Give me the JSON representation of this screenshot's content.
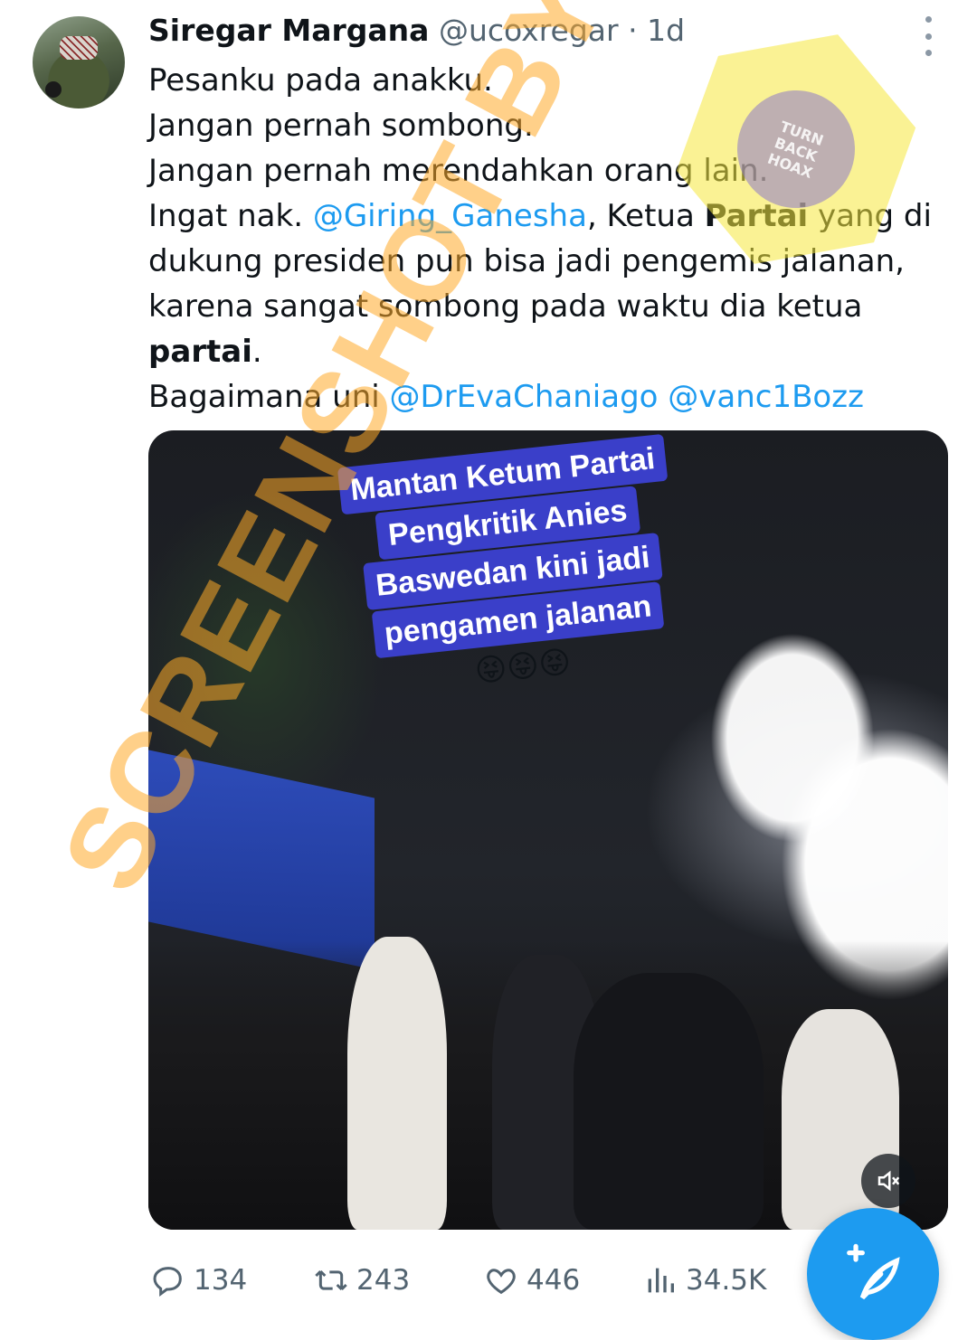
{
  "tweet": {
    "author_name": "Siregar Margana",
    "handle": "@ucoxregar",
    "separator": "·",
    "time": "1d",
    "lines": [
      [
        {
          "t": "Pesanku pada anakku."
        }
      ],
      [
        {
          "t": "Jangan pernah sombong."
        }
      ],
      [
        {
          "t": "Jangan pernah merendahkan orang lain."
        }
      ],
      [
        {
          "t": "Ingat nak. "
        },
        {
          "t": "@Giring_Ganesha",
          "k": "mention"
        },
        {
          "t": ", Ketua "
        },
        {
          "t": "Partai",
          "k": "bold"
        },
        {
          "t": "  yang di"
        }
      ],
      [
        {
          "t": "dukung presiden pun bisa jadi pengemis jalanan,"
        }
      ],
      [
        {
          "t": "karena sangat sombong pada waktu dia ketua"
        }
      ],
      [
        {
          "t": "partai",
          "k": "bold"
        },
        {
          "t": "."
        }
      ],
      [
        {
          "t": "Bagaimana uni "
        },
        {
          "t": "@DrEvaChaniago",
          "k": "mention"
        },
        {
          "t": " "
        },
        {
          "t": "@vanc1Bozz",
          "k": "mention"
        }
      ]
    ]
  },
  "media": {
    "overlay_lines": [
      "Mantan Ketum Partai",
      "Pengkritik Anies",
      "Baswedan kini jadi",
      "pengamen jalanan"
    ],
    "overlay_emojis": "😝😝😝",
    "mute_icon": "speaker-muted-icon"
  },
  "watermark": {
    "text": "SCREENSHOT BY"
  },
  "stats": {
    "replies": "134",
    "retweets": "243",
    "likes": "446",
    "views": "34.5K"
  },
  "colors": {
    "accent": "#1d9bf0",
    "secondary_text": "#536471"
  }
}
